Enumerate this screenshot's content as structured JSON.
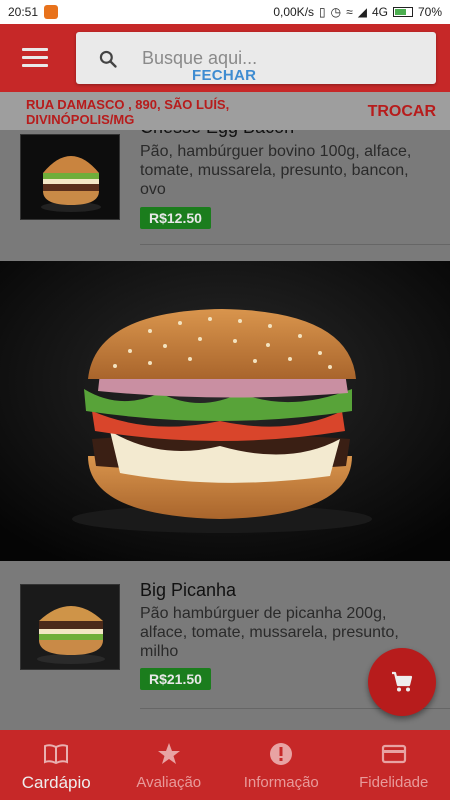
{
  "status": {
    "time": "20:51",
    "speed": "0,00K/s",
    "network": "4G",
    "battery": "70%",
    "battery_level": 0.7
  },
  "search": {
    "placeholder": "Busque aqui...",
    "close_label": "FECHAR"
  },
  "address": {
    "text": "RUA DAMASCO , 890, SÃO LUÍS, DIVINÓPOLIS/MG",
    "change_label": "TROCAR"
  },
  "items": [
    {
      "name": "Chesse Egg Bacon",
      "description": "Pão, hambúrguer bovino 100g, alface, tomate, mussarela, presunto, bancon, ovo",
      "price": "R$12.50"
    },
    {
      "name": "Big Picanha",
      "description": "Pão hambúrguer de picanha 200g, alface, tomate, mussarela, presunto, milho",
      "price": "R$21.50"
    }
  ],
  "nav": [
    {
      "label": "Cardápio",
      "icon": "book-icon",
      "active": true
    },
    {
      "label": "Avaliação",
      "icon": "star-icon",
      "active": false
    },
    {
      "label": "Informação",
      "icon": "info-icon",
      "active": false
    },
    {
      "label": "Fidelidade",
      "icon": "card-icon",
      "active": false
    }
  ],
  "colors": {
    "primary": "#c62828",
    "price_green": "#1b7d1d",
    "link_blue": "#3f8cd1"
  }
}
